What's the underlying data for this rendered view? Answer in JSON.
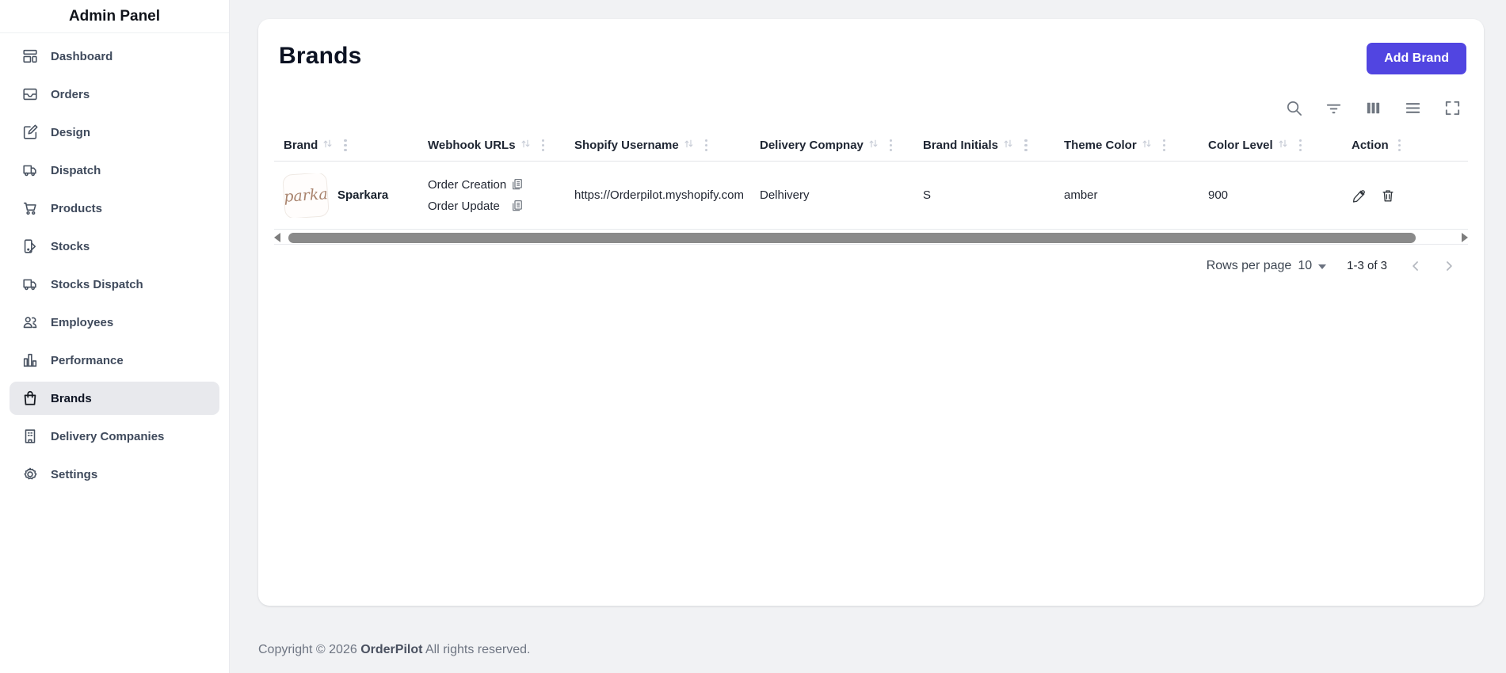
{
  "app_title": "Admin Panel",
  "sidebar": {
    "items": [
      {
        "id": "dashboard",
        "label": "Dashboard",
        "icon": "dashboard-icon",
        "active": false
      },
      {
        "id": "orders",
        "label": "Orders",
        "icon": "inbox-icon",
        "active": false
      },
      {
        "id": "design",
        "label": "Design",
        "icon": "edit-square-icon",
        "active": false
      },
      {
        "id": "dispatch",
        "label": "Dispatch",
        "icon": "truck-icon",
        "active": false
      },
      {
        "id": "products",
        "label": "Products",
        "icon": "cart-icon",
        "active": false
      },
      {
        "id": "stocks",
        "label": "Stocks",
        "icon": "swatch-icon",
        "active": false
      },
      {
        "id": "stocks-dispatch",
        "label": "Stocks Dispatch",
        "icon": "truck-icon",
        "active": false
      },
      {
        "id": "employees",
        "label": "Employees",
        "icon": "people-icon",
        "active": false
      },
      {
        "id": "performance",
        "label": "Performance",
        "icon": "bar-chart-icon",
        "active": false
      },
      {
        "id": "brands",
        "label": "Brands",
        "icon": "shopping-bag-icon",
        "active": true
      },
      {
        "id": "delivery-companies",
        "label": "Delivery Companies",
        "icon": "building-icon",
        "active": false
      },
      {
        "id": "settings",
        "label": "Settings",
        "icon": "gear-icon",
        "active": false
      }
    ]
  },
  "page": {
    "title": "Brands",
    "add_button_label": "Add Brand"
  },
  "toolbar": {
    "icons": [
      "search-icon",
      "filter-icon",
      "columns-icon",
      "density-icon",
      "fullscreen-icon"
    ]
  },
  "table": {
    "columns": [
      {
        "label": "Brand",
        "sortable": true
      },
      {
        "label": "Webhook URLs",
        "sortable": true
      },
      {
        "label": "Shopify Username",
        "sortable": true
      },
      {
        "label": "Delivery Compnay",
        "sortable": true
      },
      {
        "label": "Brand Initials",
        "sortable": true
      },
      {
        "label": "Theme Color",
        "sortable": true
      },
      {
        "label": "Color Level",
        "sortable": true
      },
      {
        "label": "Action",
        "sortable": false
      }
    ],
    "row": {
      "brand_name": "Sparkara",
      "brand_logo_text": "parka",
      "webhooks": [
        "Order Creation",
        "Order Update"
      ],
      "shopify_username": "https://Orderpilot.myshopify.com",
      "delivery_company": "Delhivery",
      "brand_initials": "S",
      "theme_color": "amber",
      "color_level": "900"
    }
  },
  "pagination": {
    "rows_per_page_label": "Rows per page",
    "rows_per_page_value": "10",
    "range_label": "1-3 of 3"
  },
  "footer": {
    "prefix": "Copyright © 2026 ",
    "brand": "OrderPilot",
    "suffix": " All rights reserved."
  },
  "colors": {
    "accent": "#5145e1",
    "sidebar_active_bg": "#e8e9ed",
    "page_background": "#f1f2f4",
    "logo_text_color": "#a9846e"
  }
}
